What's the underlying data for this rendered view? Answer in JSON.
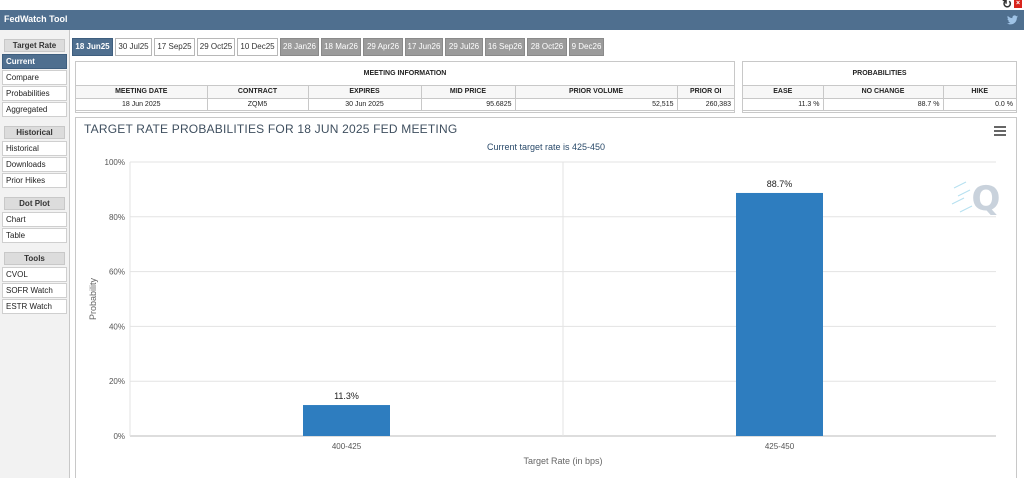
{
  "app": {
    "title": "FedWatch Tool"
  },
  "sidebar": {
    "sections": [
      {
        "title": "Target Rate",
        "items": [
          "Current",
          "Compare",
          "Probabilities",
          "Aggregated"
        ]
      },
      {
        "title": "Historical",
        "items": [
          "Historical",
          "Downloads",
          "Prior Hikes"
        ]
      },
      {
        "title": "Dot Plot",
        "items": [
          "Chart",
          "Table"
        ]
      },
      {
        "title": "Tools",
        "items": [
          "CVOL",
          "SOFR Watch",
          "ESTR Watch"
        ]
      }
    ]
  },
  "tabs": [
    "18 Jun25",
    "30 Jul25",
    "17 Sep25",
    "29 Oct25",
    "10 Dec25",
    "28 Jan26",
    "18 Mar26",
    "29 Apr26",
    "17 Jun26",
    "29 Jul26",
    "16 Sep26",
    "28 Oct26",
    "9 Dec26"
  ],
  "meeting_info": {
    "title": "MEETING INFORMATION",
    "headers": [
      "MEETING DATE",
      "CONTRACT",
      "EXPIRES",
      "MID PRICE",
      "PRIOR VOLUME",
      "PRIOR OI"
    ],
    "row": [
      "18 Jun 2025",
      "ZQM5",
      "30 Jun 2025",
      "95.6825",
      "52,515",
      "260,383"
    ]
  },
  "probabilities": {
    "title": "PROBABILITIES",
    "headers": [
      "EASE",
      "NO CHANGE",
      "HIKE"
    ],
    "row": [
      "11.3 %",
      "88.7 %",
      "0.0 %"
    ]
  },
  "chart": {
    "title": "TARGET RATE PROBABILITIES FOR 18 JUN 2025 FED MEETING",
    "subtitle": "Current target rate is 425-450"
  },
  "chart_data": {
    "type": "bar",
    "title": "TARGET RATE PROBABILITIES FOR 18 JUN 2025 FED MEETING",
    "subtitle": "Current target rate is 425-450",
    "categories": [
      "400-425",
      "425-450"
    ],
    "values": [
      11.3,
      88.7
    ],
    "value_labels": [
      "11.3%",
      "88.7%"
    ],
    "xlabel": "Target Rate (in bps)",
    "ylabel": "Probability",
    "ylim": [
      0,
      100
    ],
    "yticks": [
      "0%",
      "20%",
      "40%",
      "60%",
      "80%",
      "100%"
    ],
    "grid": true,
    "bar_color": "#2e7dbf"
  }
}
